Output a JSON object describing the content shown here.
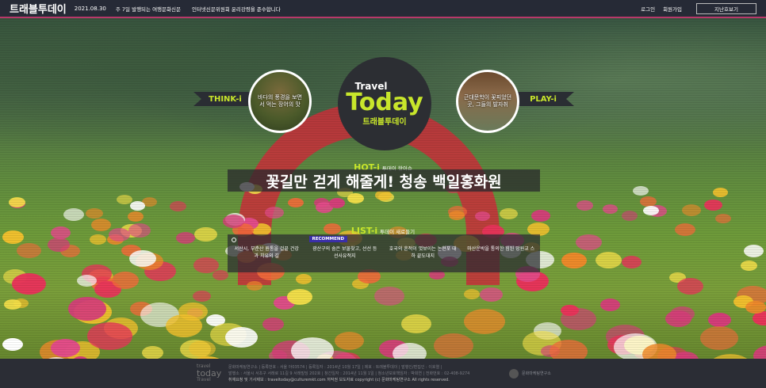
{
  "header": {
    "logo": "트래블투데이",
    "date": "2021.08.30",
    "tagline": "주 7일 발행되는 여행문화신문",
    "ethics": "인터넷신문위원회 윤리강령을 준수합니다",
    "login": "로그인",
    "signup": "회원가입",
    "archive_button": "지난호보기"
  },
  "center_logo": {
    "travel": "Travel",
    "today": "Today",
    "korean": "트래블투데이"
  },
  "think": {
    "label": "THINK-i",
    "text": "바다의 풍경을 보면서 먹는 장어의 맛"
  },
  "play": {
    "label": "PLAY-i",
    "text": "근대문학이 꽃피었던 곳, 그들의 발자취"
  },
  "hot": {
    "label": "HOT-i",
    "sub": "투데이 핫이슈",
    "headline": "꽃길만 걷게 해줄게! 청송 백일홍화원"
  },
  "list": {
    "label": "LIST-i",
    "sub": "투데이 새로들기",
    "items": [
      {
        "text": "서산시, 부춘산 원통을 걸끝 건강과 치유의 길",
        "badge": ""
      },
      {
        "text": "광산구의 숨은 보물찾고, 선선 등 선사유적지",
        "badge": "RECOMMEND"
      },
      {
        "text": "호국의 흔적이 엿보이는 논현포 대하 끝도대지",
        "badge": ""
      },
      {
        "text": "마산운박을 통의한 힘된 망원교 스",
        "badge": ""
      }
    ]
  },
  "footer": {
    "logo_line1": "travel",
    "logo_line2": "today",
    "logo_line3": "Travel",
    "info1": "문화마케팅연구소 | 등록번호 : 서울 아03574 | 등록일자 : 2014년 10월 17일 | 제호 : 트래블투데이 | 발행인/편집인 : 이호열 |",
    "info2": "발행소 : 서울시 서초구 서래로 11길 9 서래빌딩 202호 | 창간일자 : 2014년 11월 1일 | 청소년보호책임자 : 박희연 | 전화번호 : 02-408-9274",
    "info3": "취재요청 및 기사제보 : traveltoday@culturemkt.com    저작권 보도자료    copyright (c) 문화마케팅연구소 All rights reserved.",
    "org": "문화마케팅연구소"
  }
}
